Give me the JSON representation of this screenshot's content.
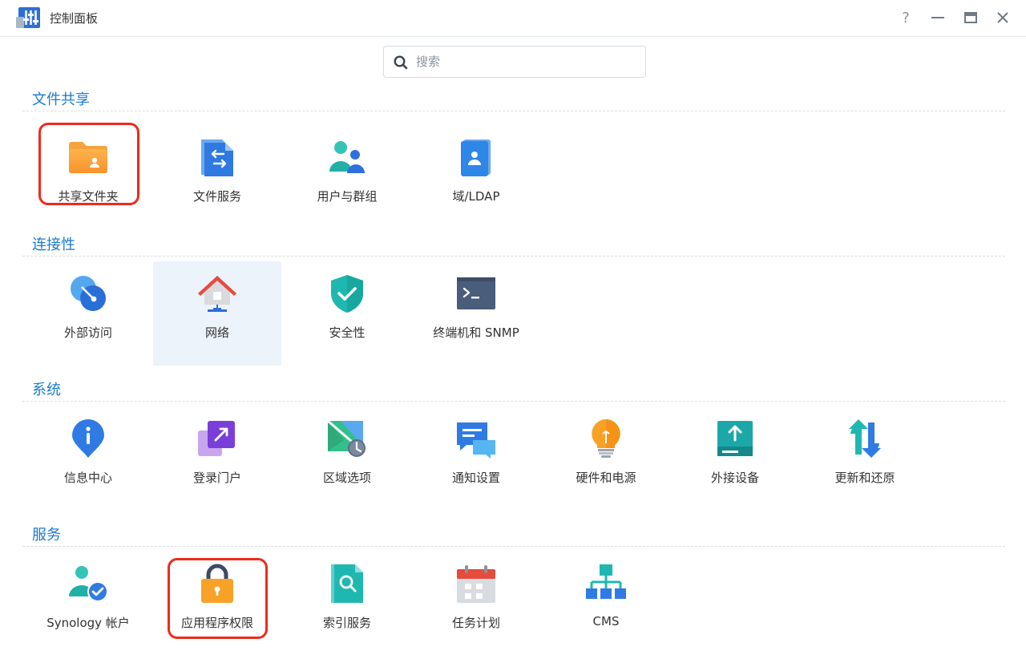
{
  "window": {
    "title": "控制面板",
    "controls": {
      "help": "?",
      "minimize": "minimize",
      "maximize": "maximize",
      "close": "close"
    }
  },
  "search": {
    "placeholder": "搜索",
    "value": ""
  },
  "sections": [
    {
      "title": "文件共享",
      "items": [
        {
          "label": "共享文件夹",
          "icon": "shared-folder-icon",
          "highlighted": true
        },
        {
          "label": "文件服务",
          "icon": "file-services-icon"
        },
        {
          "label": "用户与群组",
          "icon": "user-group-icon"
        },
        {
          "label": "域/LDAP",
          "icon": "domain-ldap-icon"
        }
      ]
    },
    {
      "title": "连接性",
      "items": [
        {
          "label": "外部访问",
          "icon": "external-access-icon"
        },
        {
          "label": "网络",
          "icon": "network-icon",
          "selected": true
        },
        {
          "label": "安全性",
          "icon": "security-shield-icon"
        },
        {
          "label": "终端机和 SNMP",
          "icon": "terminal-icon"
        }
      ]
    },
    {
      "title": "系统",
      "items": [
        {
          "label": "信息中心",
          "icon": "info-center-icon"
        },
        {
          "label": "登录门户",
          "icon": "login-portal-icon"
        },
        {
          "label": "区域选项",
          "icon": "regional-options-icon"
        },
        {
          "label": "通知设置",
          "icon": "notification-icon"
        },
        {
          "label": "硬件和电源",
          "icon": "hardware-power-icon"
        },
        {
          "label": "外接设备",
          "icon": "external-devices-icon"
        },
        {
          "label": "更新和还原",
          "icon": "update-restore-icon"
        }
      ]
    },
    {
      "title": "服务",
      "items": [
        {
          "label": "Synology 帐户",
          "icon": "synology-account-icon"
        },
        {
          "label": "应用程序权限",
          "icon": "application-privileges-icon",
          "highlighted": true
        },
        {
          "label": "索引服务",
          "icon": "indexing-service-icon"
        },
        {
          "label": "任务计划",
          "icon": "task-scheduler-icon"
        },
        {
          "label": "CMS",
          "icon": "cms-icon"
        }
      ]
    }
  ],
  "colors": {
    "accent": "#1a7ad4",
    "highlight": "#f02a1a",
    "selected_bg": "#edf3fb"
  }
}
